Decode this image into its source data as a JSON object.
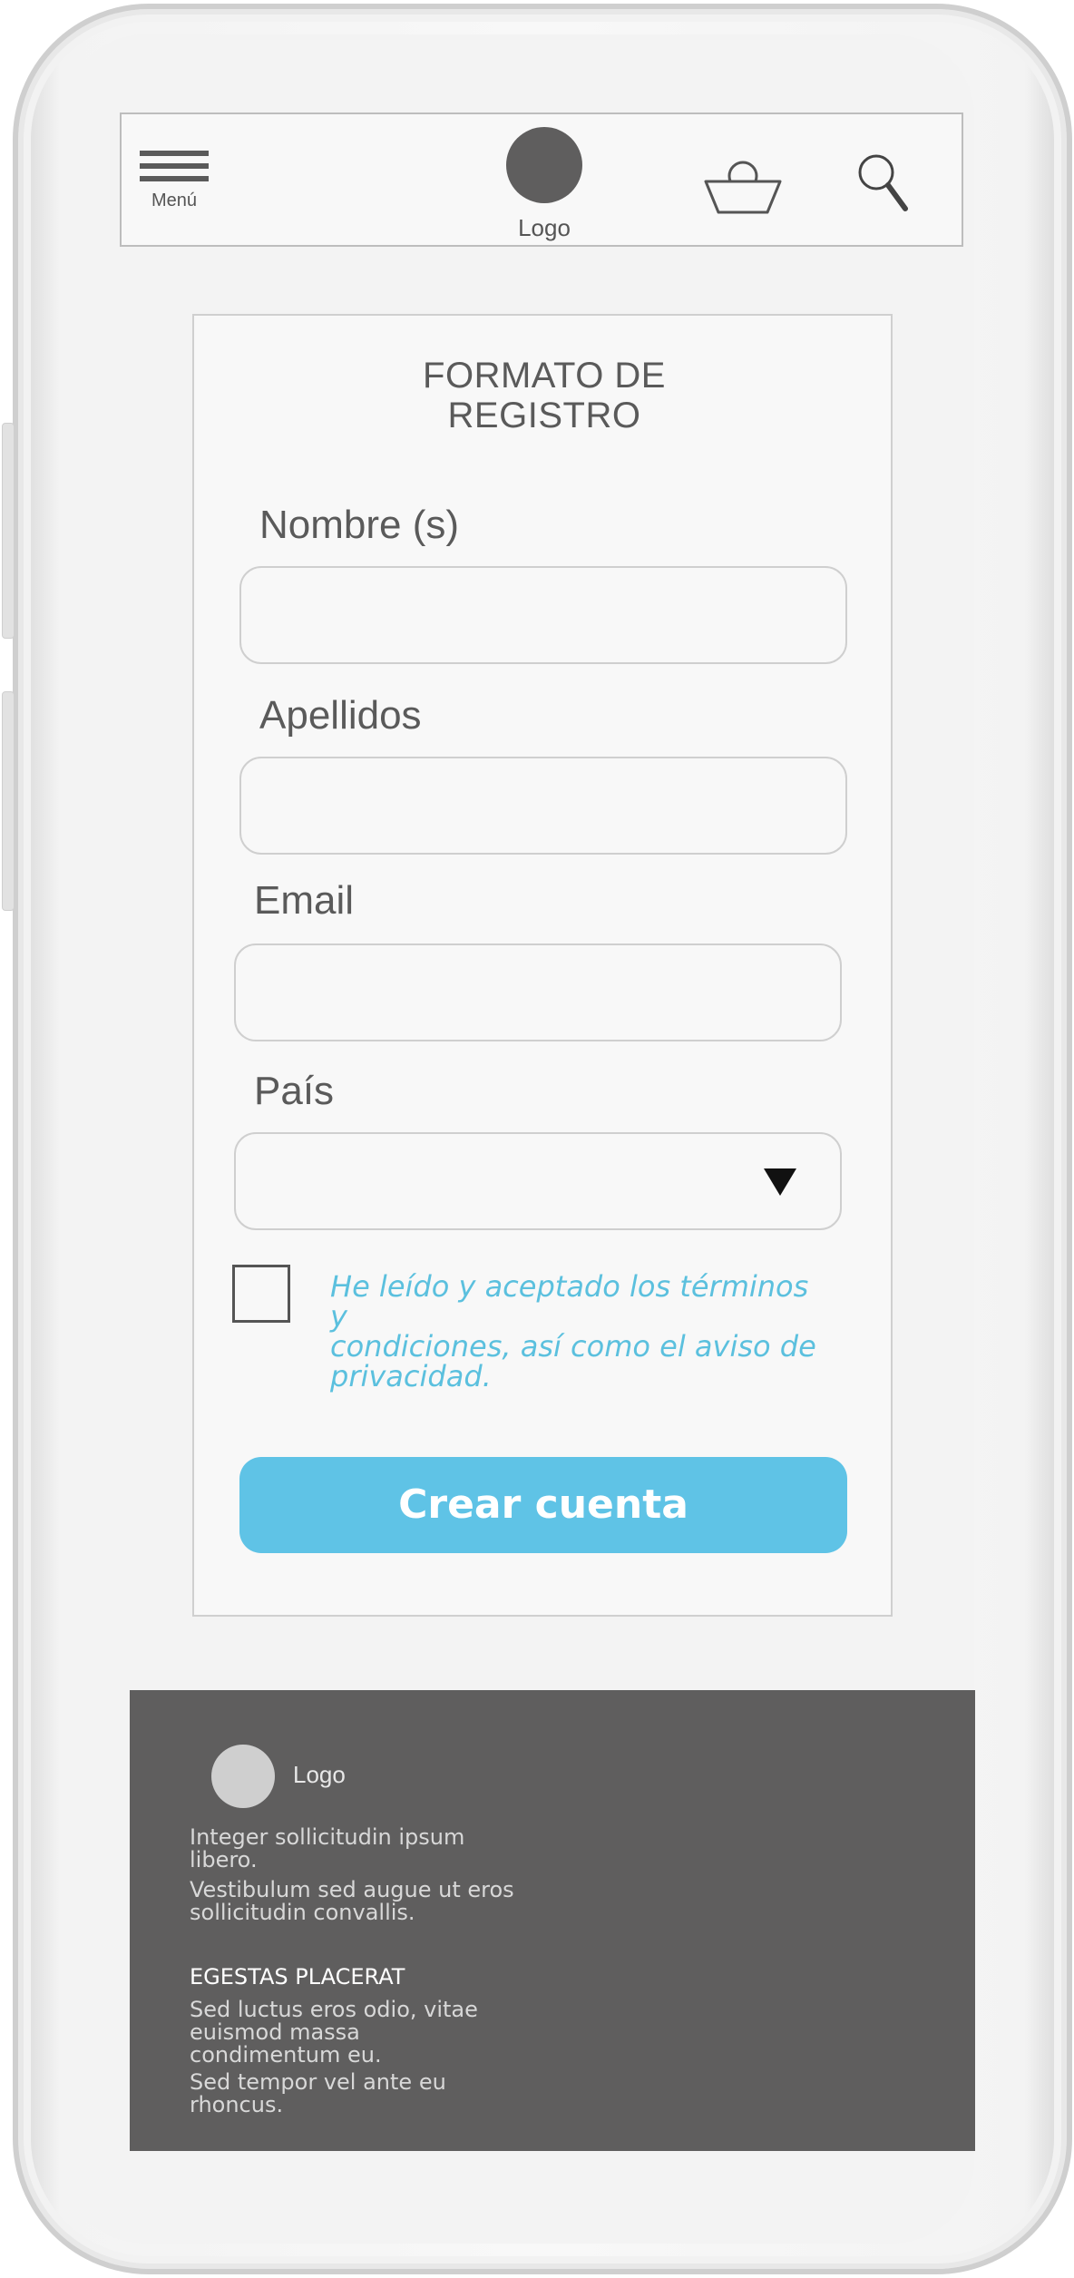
{
  "header": {
    "menu_label": "Menú",
    "logo_label": "Logo",
    "icons": [
      "hamburger-icon",
      "basket-icon",
      "search-icon"
    ]
  },
  "form": {
    "title_line1": "FORMATO DE",
    "title_line2": "REGISTRO",
    "fields": [
      {
        "label": "Nombre (s)",
        "value": ""
      },
      {
        "label": "Apellidos",
        "value": ""
      },
      {
        "label": "Email",
        "value": ""
      },
      {
        "label": "País",
        "value": ""
      }
    ],
    "terms_line1": "He leído y aceptado los términos y",
    "terms_line2": "condiciones, así como el aviso de",
    "terms_line3": "privacidad.",
    "terms_checked": false,
    "submit_label": "Crear cuenta"
  },
  "footer": {
    "logo_label": "Logo",
    "text1_line1": "Integer sollicitudin ipsum",
    "text1_line2": "libero.",
    "text2_line1": "Vestibulum sed augue ut eros",
    "text2_line2": "sollicitudin convallis.",
    "heading": "EGESTAS PLACERAT",
    "text3_line1": "Sed luctus eros odio, vitae",
    "text3_line2": "euismod massa",
    "text3_line3": "condimentum eu.",
    "text4_line1": "Sed tempor vel ante eu",
    "text4_line2": "rhoncus."
  },
  "colors": {
    "accent": "#5fc3e6",
    "link": "#5bc0de",
    "footer_bg": "#5f5e5e",
    "logo": "#5f5e5e"
  }
}
